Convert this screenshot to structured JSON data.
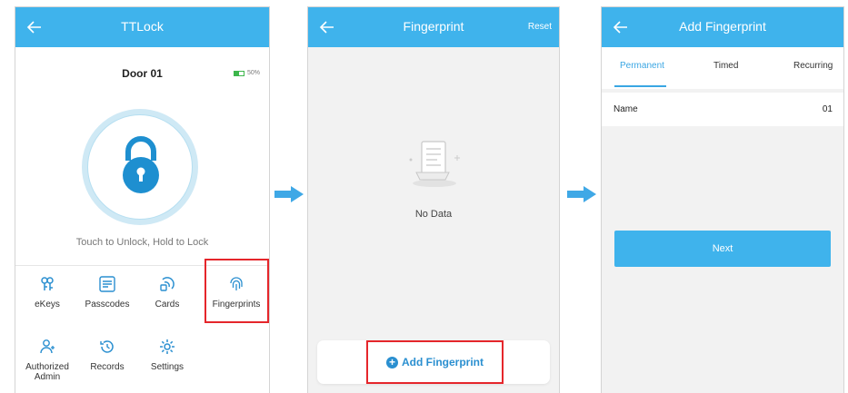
{
  "colors": {
    "brand": "#3fb3ec",
    "highlight": "#e5262b",
    "accent": "#2a8fd0",
    "battery": "#3cb64b"
  },
  "screen1": {
    "title": "TTLock",
    "door_name": "Door 01",
    "battery": "50%",
    "hint": "Touch to Unlock, Hold to Lock",
    "menu": [
      {
        "label": "eKeys",
        "icon": "ekey-icon"
      },
      {
        "label": "Passcodes",
        "icon": "passcode-icon"
      },
      {
        "label": "Cards",
        "icon": "card-icon"
      },
      {
        "label": "Fingerprints",
        "icon": "fingerprint-icon"
      },
      {
        "label": "Authorized\nAdmin",
        "icon": "admin-icon"
      },
      {
        "label": "Records",
        "icon": "records-icon"
      },
      {
        "label": "Settings",
        "icon": "settings-icon"
      }
    ]
  },
  "screen2": {
    "title": "Fingerprint",
    "reset": "Reset",
    "empty_text": "No Data",
    "add_button": "Add Fingerprint"
  },
  "screen3": {
    "title": "Add Fingerprint",
    "tabs": [
      "Permanent",
      "Timed",
      "Recurring"
    ],
    "active_tab": "Permanent",
    "name_label": "Name",
    "name_value": "01",
    "next": "Next"
  }
}
